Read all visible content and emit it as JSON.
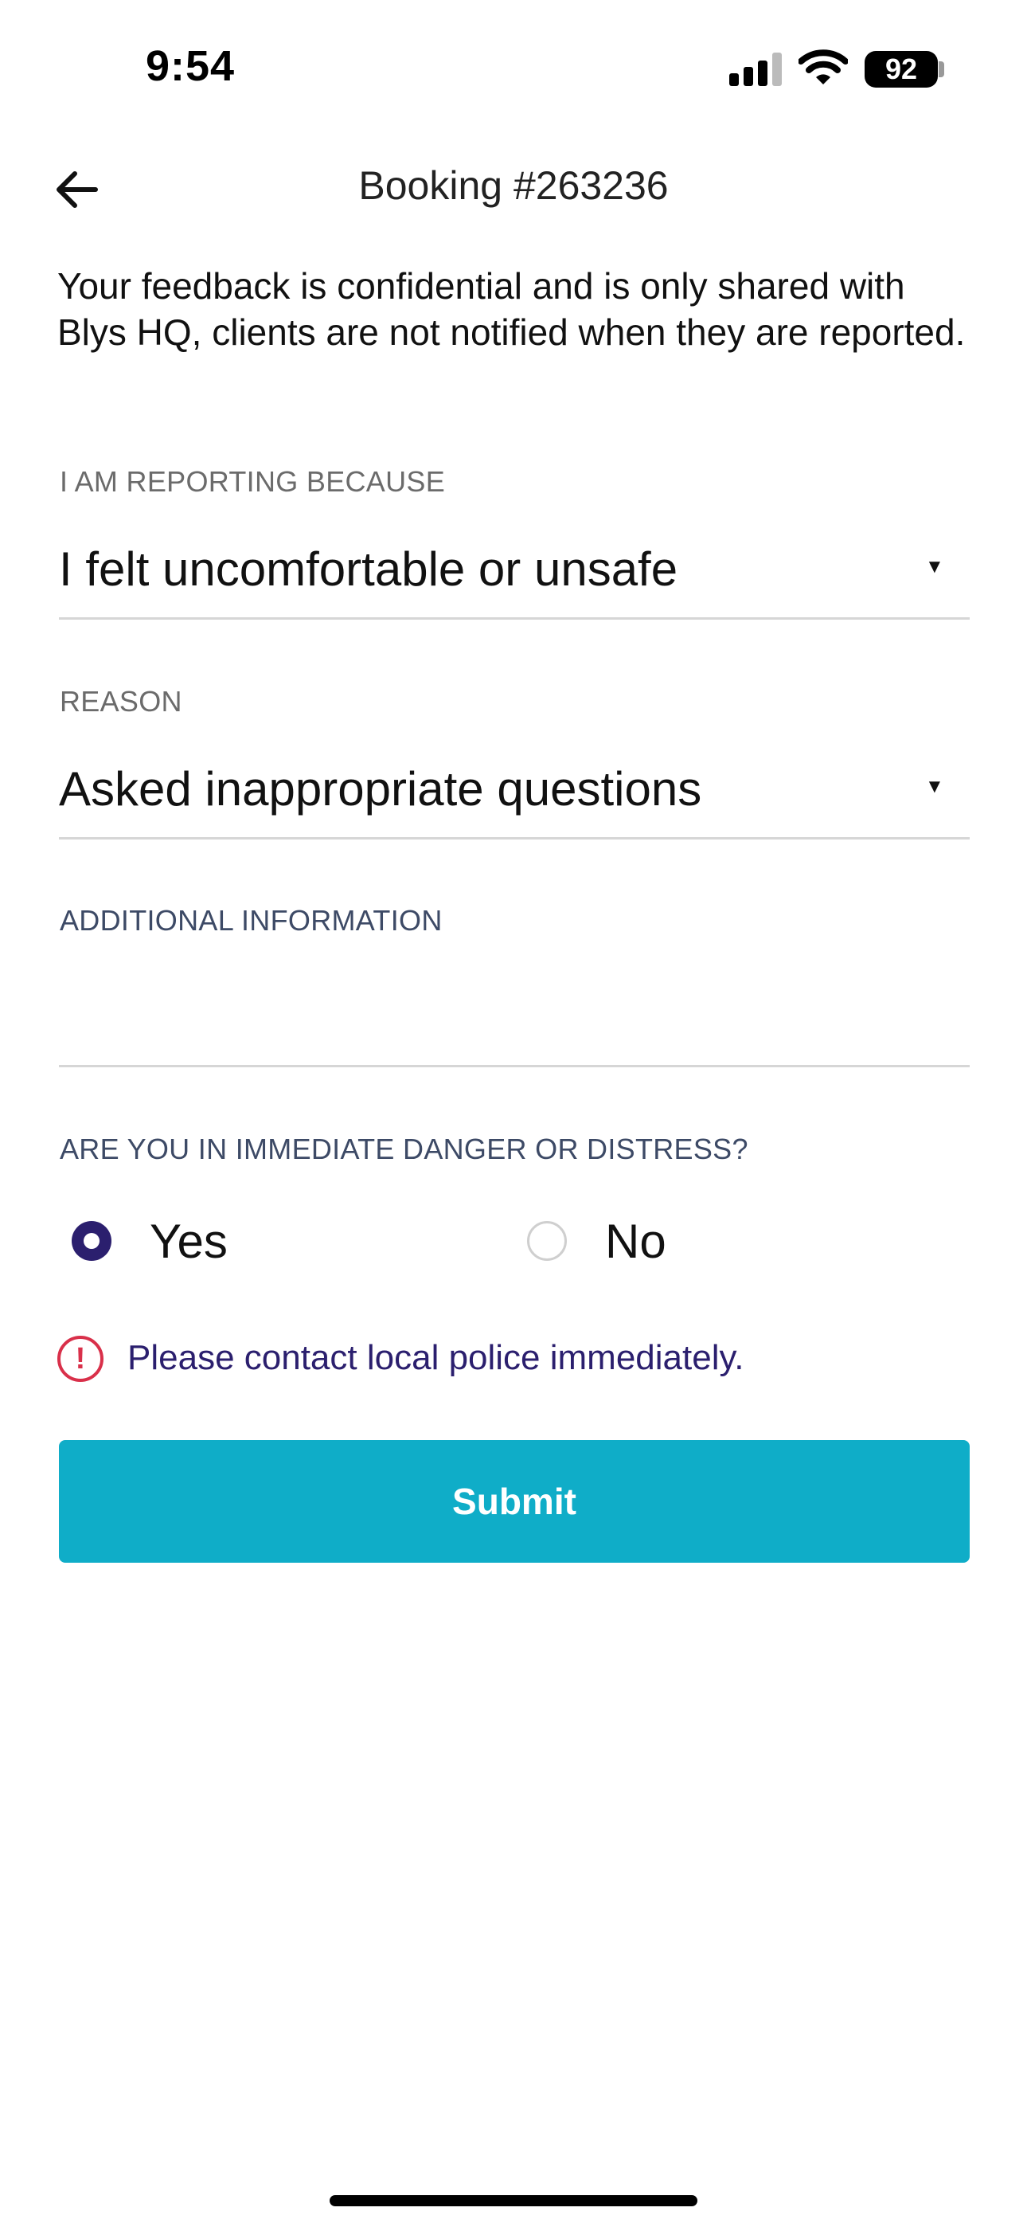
{
  "status_bar": {
    "time": "9:54",
    "battery": "92"
  },
  "header": {
    "title": "Booking #263236",
    "back_icon": "arrow-left-icon"
  },
  "intro": "Your feedback is confidential and is only shared with Blys HQ, clients are not notified when they are reported.",
  "form": {
    "reporting_label": "I AM REPORTING BECAUSE",
    "reporting_value": "I felt uncomfortable or unsafe",
    "reason_label": "REASON",
    "reason_value": "Asked inappropriate questions",
    "additional_label": "ADDITIONAL INFORMATION",
    "additional_value": "",
    "danger_label": "ARE YOU IN IMMEDIATE DANGER OR DISTRESS?",
    "options": [
      {
        "label": "Yes",
        "selected": true
      },
      {
        "label": "No",
        "selected": false
      }
    ],
    "alert_icon": "exclamation-circle-icon",
    "alert_text": "Please contact local police immediately.",
    "submit_label": "Submit"
  },
  "colors": {
    "accent": "#0fadc8",
    "radio_selected": "#2b1f6e",
    "alert": "#d9304a",
    "alert_text": "#2b1f6e"
  }
}
